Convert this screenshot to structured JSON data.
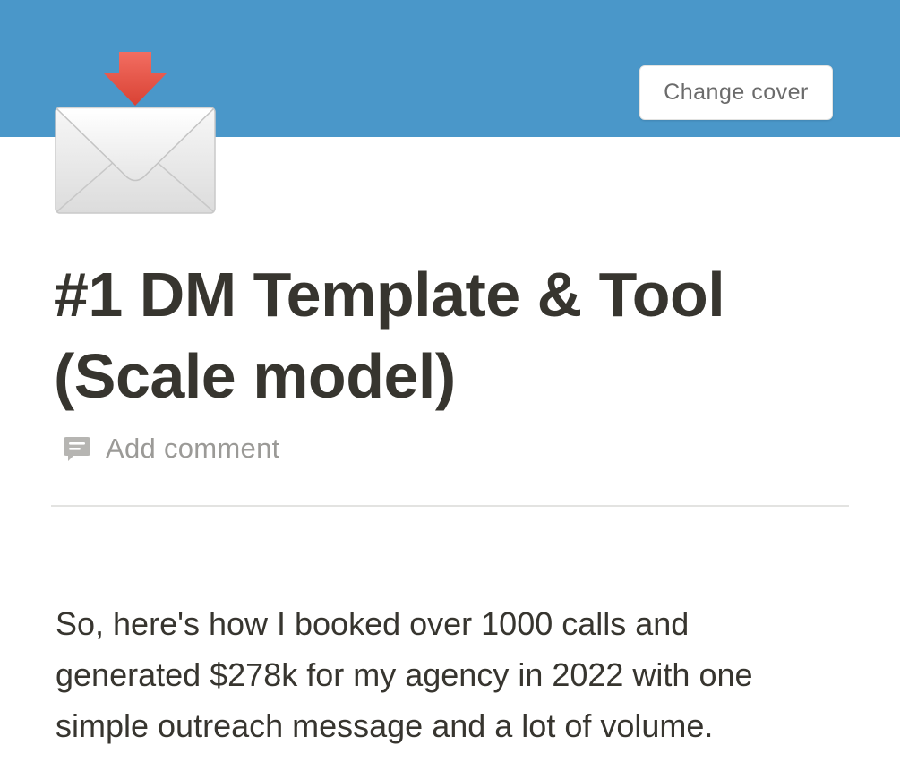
{
  "cover": {
    "color": "#4a97c9",
    "change_cover_label": "Change cover"
  },
  "page_icon": {
    "name": "envelope-with-arrow-icon",
    "arrow_color": "#e8534a"
  },
  "page": {
    "title_line1": "#1 DM Template & Tool",
    "title_line2": "(Scale model)",
    "add_comment_label": "Add comment",
    "body_line1": "So, here's how I booked over 1000 calls and",
    "body_line2": "generated $278k for my agency in 2022 with one",
    "body_line3": "simple outreach message and a lot of volume."
  },
  "colors": {
    "text": "#37352f",
    "muted": "#9b9a97",
    "divider": "#e3e3e1"
  }
}
